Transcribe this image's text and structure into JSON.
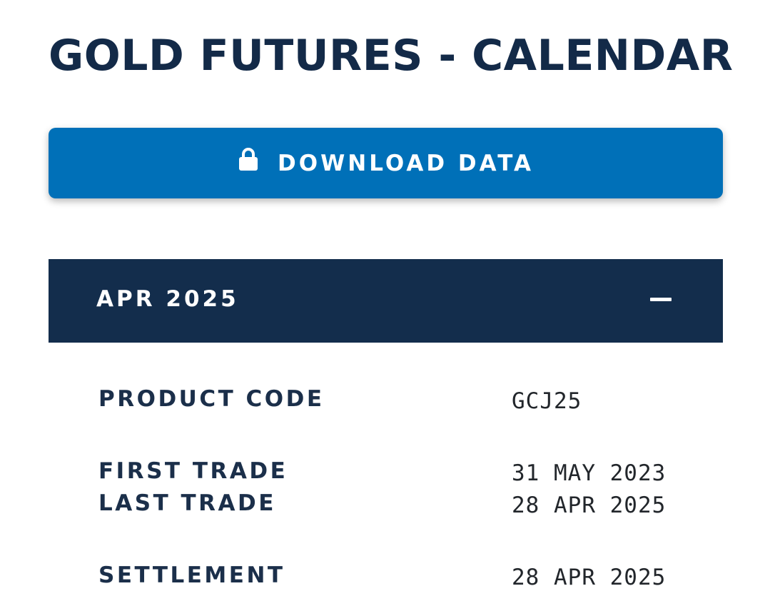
{
  "page": {
    "title": "GOLD FUTURES - CALENDAR"
  },
  "download_button": {
    "label": "DOWNLOAD DATA",
    "icon": "lock-icon"
  },
  "accordion": {
    "title": "APR 2025",
    "toggle_icon": "minus-icon",
    "expanded": true
  },
  "details": {
    "product_code": {
      "label": "PRODUCT CODE",
      "value": "GCJ25"
    },
    "first_trade": {
      "label": "FIRST TRADE",
      "value": "31 MAY 2023"
    },
    "last_trade": {
      "label": "LAST TRADE",
      "value": "28 APR 2025"
    },
    "settlement": {
      "label": "SETTLEMENT",
      "value": "28 APR 2025"
    }
  },
  "colors": {
    "navy": "#132d4c",
    "button_blue": "#0070b8",
    "title_text": "#132a48",
    "value_text": "#22262b"
  }
}
